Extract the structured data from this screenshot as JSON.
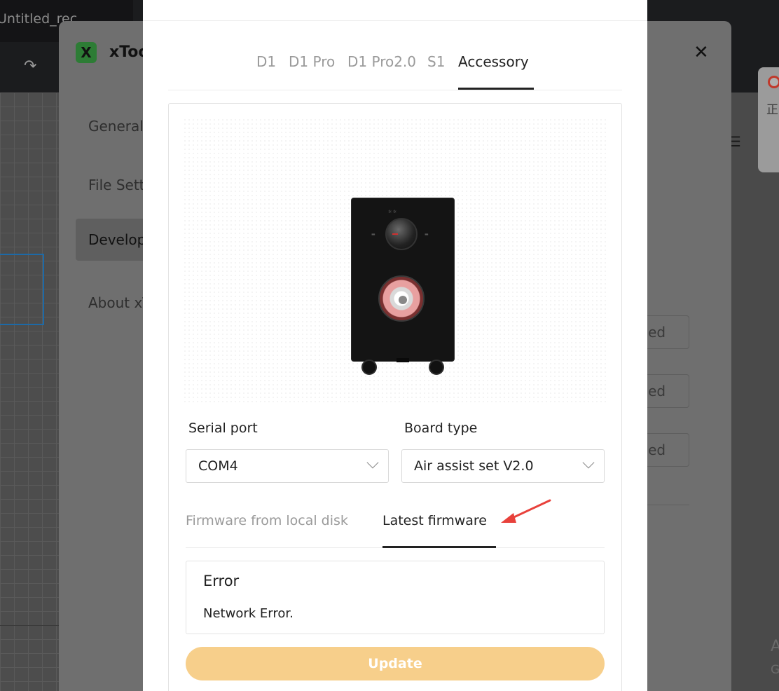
{
  "app": {
    "title": "Untitled_rec",
    "redo_icon": "redo-icon"
  },
  "toast": {
    "icon": "record-icon",
    "text": "正"
  },
  "watermark": {
    "line1": "A",
    "line2": "G"
  },
  "settings": {
    "brand": "xToo",
    "logo_letter": "X",
    "close_icon": "close-icon",
    "sidebar": [
      {
        "label": "General"
      },
      {
        "label": "File Settings"
      },
      {
        "label": "Developer"
      },
      {
        "label": "About xTool"
      }
    ],
    "ghost_buttons": [
      "lled",
      "lled",
      "lled"
    ]
  },
  "modal": {
    "tabs": [
      {
        "label": "D1"
      },
      {
        "label": "D1 Pro"
      },
      {
        "label": "D1 Pro2.0"
      },
      {
        "label": "S1"
      },
      {
        "label": "Accessory"
      }
    ],
    "active_tab": "Accessory",
    "device_image": "air-assist-device-image",
    "serial_port": {
      "label": "Serial port",
      "value": "COM4"
    },
    "board_type": {
      "label": "Board type",
      "value": "Air assist set V2.0"
    },
    "source_tabs": [
      {
        "label": "Firmware from local disk"
      },
      {
        "label": "Latest firmware"
      }
    ],
    "active_source_tab": "Latest firmware",
    "error": {
      "title": "Error",
      "message": "Network Error."
    },
    "update_button": "Update"
  },
  "colors": {
    "update_button_bg": "#f7cf8b",
    "annotation_arrow": "#e8413b",
    "logo_green": "#2d7c35"
  }
}
